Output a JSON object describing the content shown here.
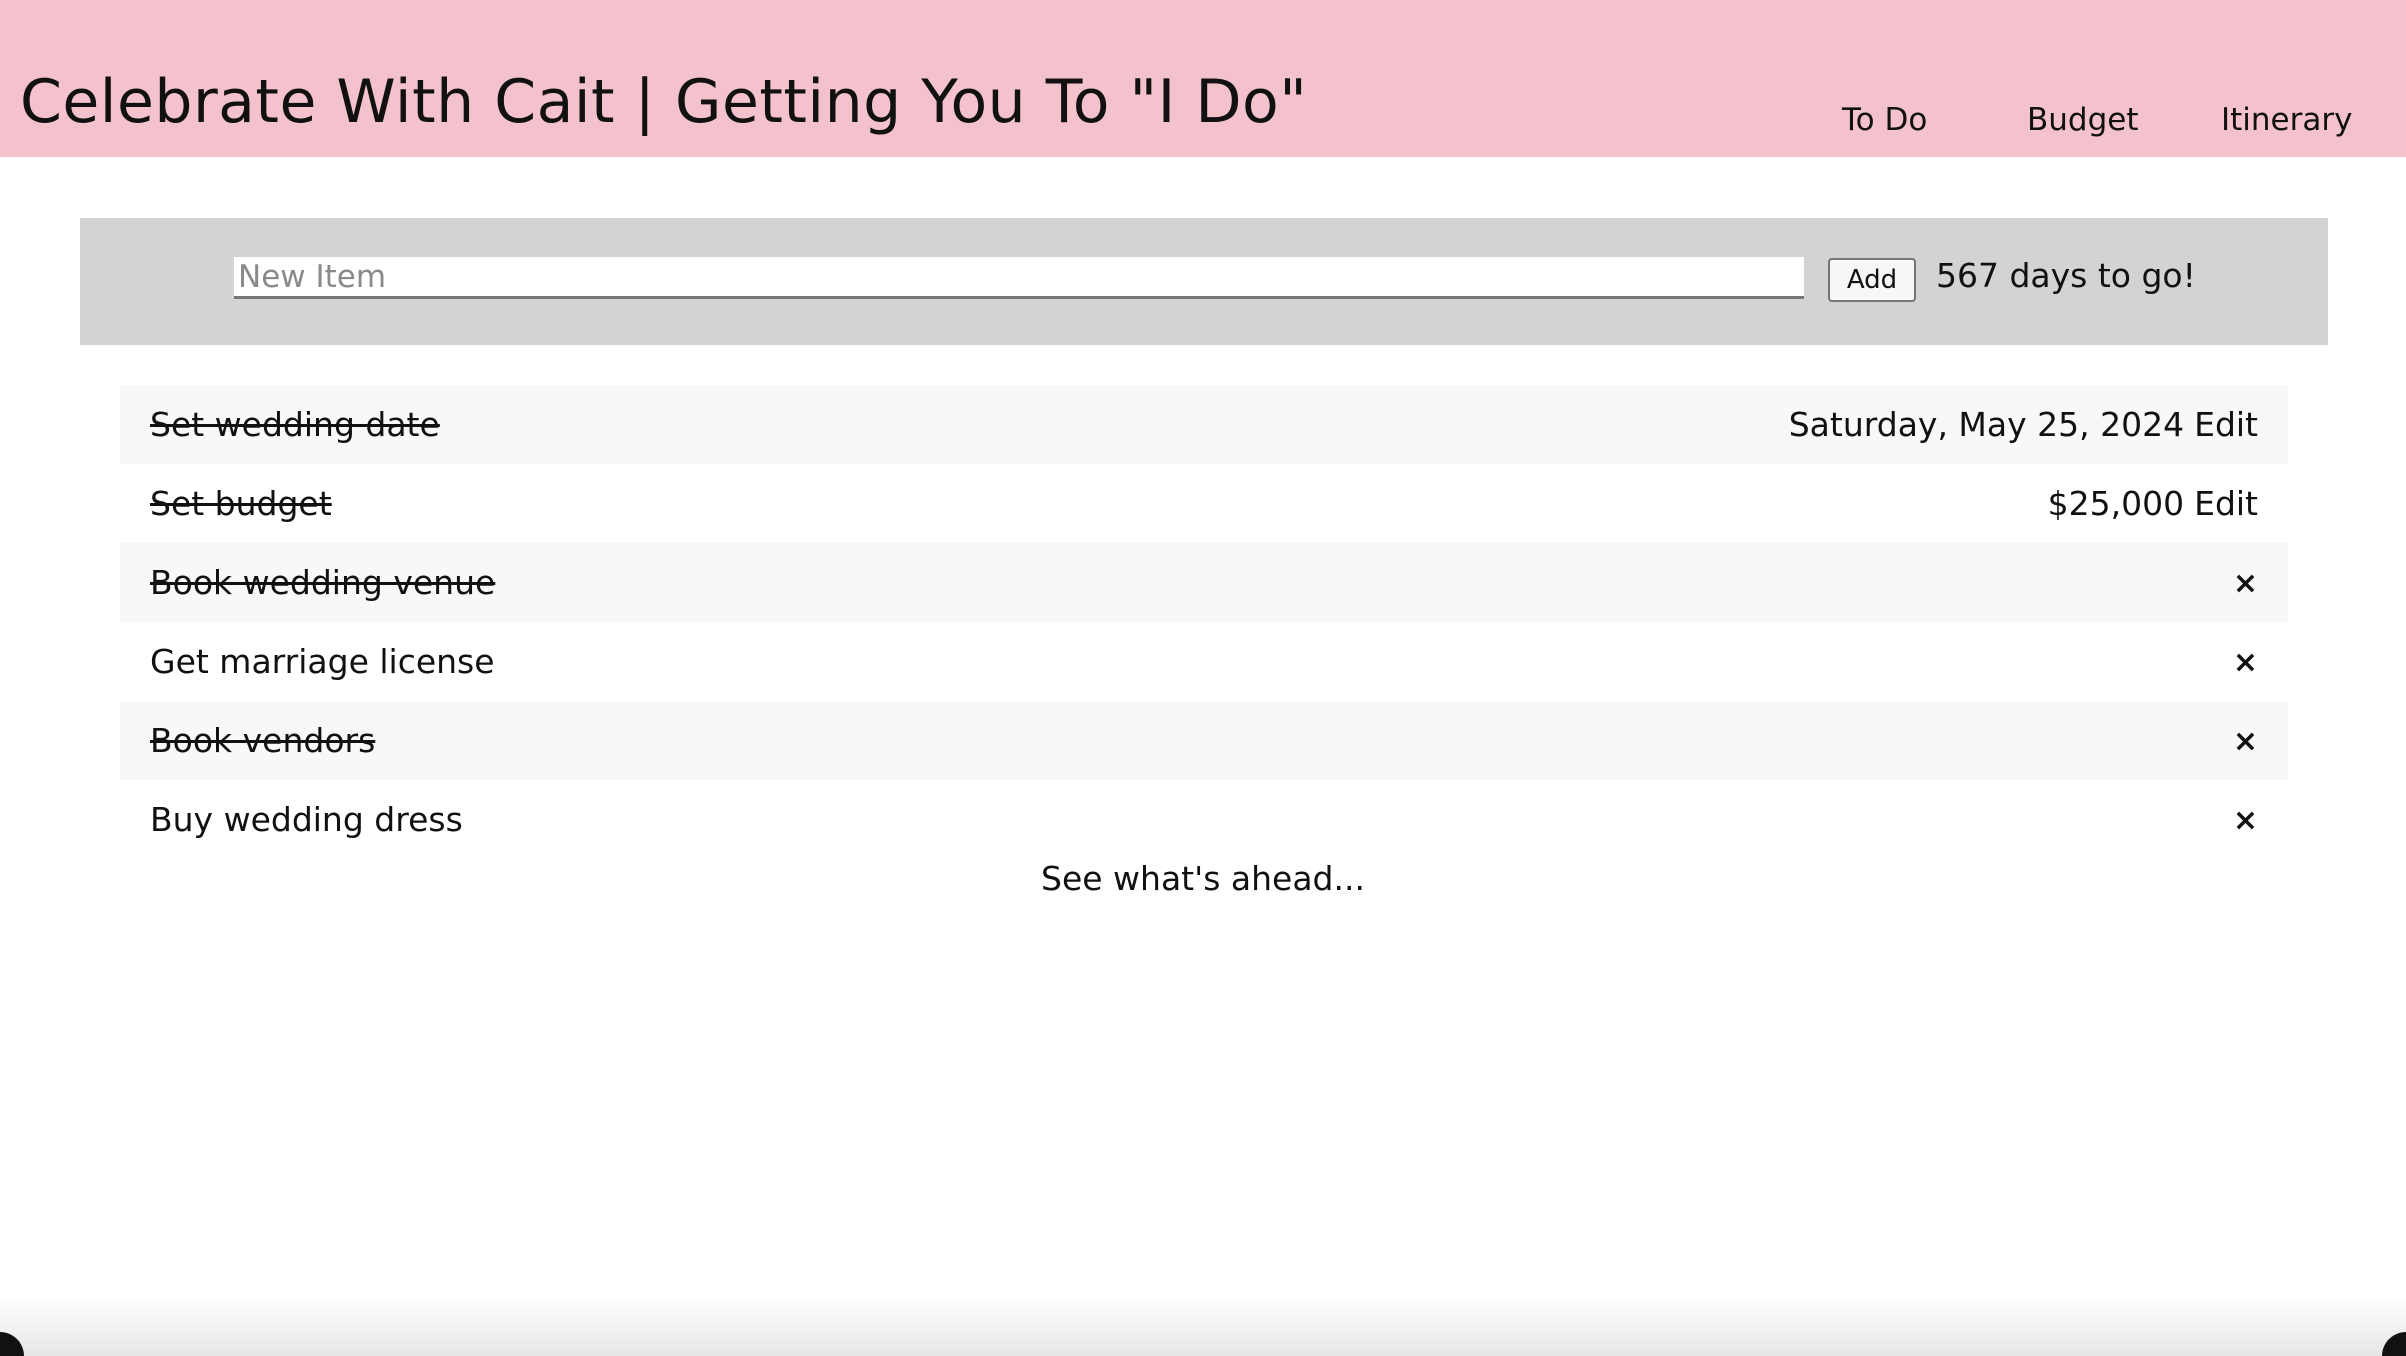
{
  "header": {
    "title": "Celebrate With Cait | Getting You To \"I Do\"",
    "nav": {
      "todo": "To Do",
      "budget": "Budget",
      "itinerary": "Itinerary"
    },
    "background_color": "#f4c2cc"
  },
  "add_bar": {
    "input_placeholder": "New Item",
    "input_value": "",
    "add_label": "Add",
    "countdown": "567 days to go!"
  },
  "todos": [
    {
      "text": "Set wedding date",
      "done": true,
      "detail": "Saturday, May 25, 2024",
      "edit_label": "Edit"
    },
    {
      "text": "Set budget",
      "done": true,
      "detail": "$25,000",
      "edit_label": "Edit"
    },
    {
      "text": "Book wedding venue",
      "done": true,
      "delete_icon": "×"
    },
    {
      "text": "Get marriage license",
      "done": false,
      "delete_icon": "×"
    },
    {
      "text": "Book vendors",
      "done": true,
      "delete_icon": "×"
    },
    {
      "text": "Buy wedding dress",
      "done": false,
      "delete_icon": "×"
    }
  ],
  "footer_link": "See what's ahead..."
}
